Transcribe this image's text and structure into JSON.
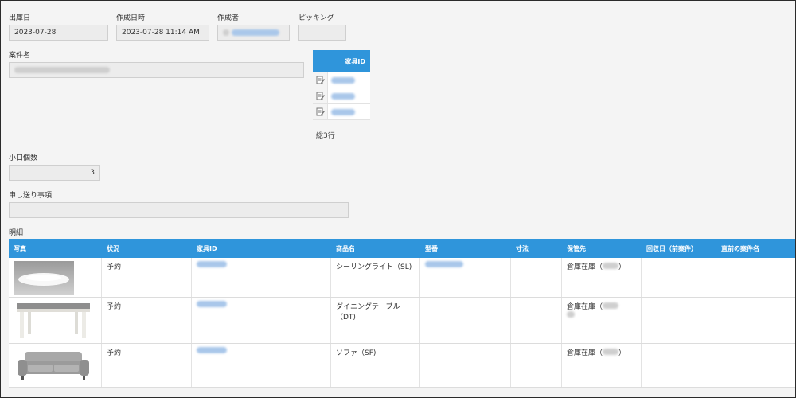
{
  "fields": {
    "ship_date": {
      "label": "出庫日",
      "value": "2023-07-28"
    },
    "created_at": {
      "label": "作成日時",
      "value": "2023-07-28 11:14 AM"
    },
    "creator": {
      "label": "作成者"
    },
    "picking": {
      "label": "ピッキング",
      "value": ""
    },
    "project_name": {
      "label": "案件名"
    },
    "small_count": {
      "label": "小口個数",
      "value": "3"
    },
    "handover": {
      "label": "申し送り事項",
      "value": ""
    }
  },
  "furniture_table": {
    "header": "家具ID",
    "rows": [
      {
        "icon": "edit-icon"
      },
      {
        "icon": "edit-icon"
      },
      {
        "icon": "edit-icon"
      }
    ],
    "total": "総3行"
  },
  "details": {
    "label": "明細",
    "columns": [
      "写真",
      "状況",
      "家具ID",
      "商品名",
      "型番",
      "寸法",
      "保管先",
      "回収日（前案件）",
      "直前の案件名"
    ],
    "rows": [
      {
        "photo": "ceiling-light-photo",
        "status": "予約",
        "product": "シーリングライト（SL)",
        "storage": "倉庫在庫（",
        "storage_close": "）"
      },
      {
        "photo": "dining-table-photo",
        "status": "予約",
        "product": "ダイニングテーブル\n（DT)",
        "storage": "倉庫在庫（",
        "storage_close": ""
      },
      {
        "photo": "sofa-photo",
        "status": "予約",
        "product": "ソファ（SF)",
        "storage": "倉庫在庫（",
        "storage_close": "）"
      }
    ]
  },
  "colors": {
    "header_blue": "#2f95db",
    "link_blue": "#3a7fd0"
  }
}
